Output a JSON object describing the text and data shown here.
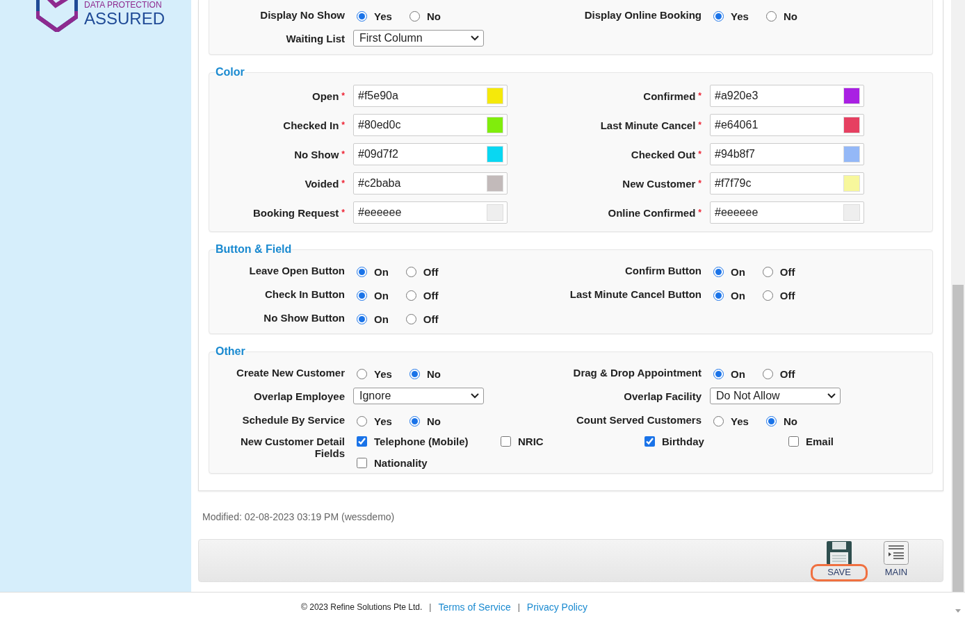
{
  "sidebar": {
    "logo_top": "DATA PROTECTION",
    "logo_bottom": "ASSURED"
  },
  "required_mark": "*",
  "sections": [
    {
      "fields": [
        {
          "label": "Display No Show",
          "required": false,
          "kind": "radio",
          "options": [
            {
              "label": "Yes",
              "selected": true
            },
            {
              "label": "No",
              "selected": false
            }
          ]
        },
        {
          "label": "Display Online Booking",
          "required": false,
          "kind": "radio",
          "options": [
            {
              "label": "Yes",
              "selected": true
            },
            {
              "label": "No",
              "selected": false
            }
          ]
        },
        {
          "label": "Waiting List",
          "required": false,
          "kind": "select",
          "value": "First Column"
        }
      ]
    },
    {
      "legend": "Color",
      "fields": [
        {
          "label": "Open",
          "required": true,
          "kind": "color",
          "value": "#f5e90a",
          "color": "#f5e90a"
        },
        {
          "label": "Confirmed",
          "required": true,
          "kind": "color",
          "value": "#a920e3",
          "color": "#a920e3"
        },
        {
          "label": "Checked In",
          "required": true,
          "kind": "color",
          "value": "#80ed0c",
          "color": "#80ed0c"
        },
        {
          "label": "Last Minute Cancel",
          "required": true,
          "kind": "color",
          "value": "#e64061",
          "color": "#e64061"
        },
        {
          "label": "No Show",
          "required": true,
          "kind": "color",
          "value": "#09d7f2",
          "color": "#09d7f2"
        },
        {
          "label": "Checked Out",
          "required": true,
          "kind": "color",
          "value": "#94b8f7",
          "color": "#94b8f7"
        },
        {
          "label": "Voided",
          "required": true,
          "kind": "color",
          "value": "#c2baba",
          "color": "#c2baba"
        },
        {
          "label": "New Customer",
          "required": true,
          "kind": "color",
          "value": "#f7f79c",
          "color": "#f7f79c"
        },
        {
          "label": "Booking Request",
          "required": true,
          "kind": "color",
          "value": "#eeeeee",
          "color": "#eeeeee"
        },
        {
          "label": "Online Confirmed",
          "required": true,
          "kind": "color",
          "value": "#eeeeee",
          "color": "#eeeeee"
        }
      ]
    },
    {
      "legend": "Button & Field",
      "fields": [
        {
          "label": "Leave Open Button",
          "required": false,
          "kind": "radio",
          "options": [
            {
              "label": "On",
              "selected": true
            },
            {
              "label": "Off",
              "selected": false
            }
          ]
        },
        {
          "label": "Confirm Button",
          "required": false,
          "kind": "radio",
          "options": [
            {
              "label": "On",
              "selected": true
            },
            {
              "label": "Off",
              "selected": false
            }
          ]
        },
        {
          "label": "Check In Button",
          "required": false,
          "kind": "radio",
          "options": [
            {
              "label": "On",
              "selected": true
            },
            {
              "label": "Off",
              "selected": false
            }
          ]
        },
        {
          "label": "Last Minute Cancel Button",
          "required": false,
          "kind": "radio",
          "options": [
            {
              "label": "On",
              "selected": true
            },
            {
              "label": "Off",
              "selected": false
            }
          ]
        },
        {
          "label": "No Show Button",
          "required": false,
          "kind": "radio",
          "options": [
            {
              "label": "On",
              "selected": true
            },
            {
              "label": "Off",
              "selected": false
            }
          ]
        }
      ]
    },
    {
      "legend": "Other",
      "fields": [
        {
          "label": "Create New Customer",
          "required": false,
          "kind": "radio",
          "options": [
            {
              "label": "Yes",
              "selected": false
            },
            {
              "label": "No",
              "selected": true
            }
          ]
        },
        {
          "label": "Drag & Drop Appointment",
          "required": false,
          "kind": "radio",
          "options": [
            {
              "label": "On",
              "selected": true
            },
            {
              "label": "Off",
              "selected": false
            }
          ]
        },
        {
          "label": "Overlap Employee",
          "required": false,
          "kind": "select",
          "value": "Ignore"
        },
        {
          "label": "Overlap Facility",
          "required": false,
          "kind": "select",
          "value": "Do Not Allow"
        },
        {
          "label": "Schedule By Service",
          "required": false,
          "kind": "radio",
          "options": [
            {
              "label": "Yes",
              "selected": false
            },
            {
              "label": "No",
              "selected": true
            }
          ]
        },
        {
          "label": "Count Served Customers",
          "required": false,
          "kind": "radio",
          "options": [
            {
              "label": "Yes",
              "selected": false
            },
            {
              "label": "No",
              "selected": true
            }
          ]
        },
        {
          "label": "New Customer Detail Fields",
          "required": false,
          "kind": "checks",
          "options": [
            {
              "label": "Telephone (Mobile)",
              "checked": true
            },
            {
              "label": "NRIC",
              "checked": false
            },
            {
              "label": "Birthday",
              "checked": true
            },
            {
              "label": "Email",
              "checked": false
            },
            {
              "label": "Nationality",
              "checked": false
            }
          ]
        }
      ]
    }
  ],
  "modified": "Modified: 02-08-2023 03:19 PM (wessdemo)",
  "toolbar": [
    {
      "label": "SAVE",
      "kind": "save",
      "highlighted": true
    },
    {
      "label": "MAIN",
      "kind": "main",
      "highlighted": false
    }
  ],
  "footer": {
    "copyright": "© 2023 Refine Solutions Pte Ltd.",
    "links": [
      {
        "separator": "|",
        "label": "Terms of Service"
      },
      {
        "separator": "|",
        "label": "Privacy Policy"
      }
    ]
  }
}
